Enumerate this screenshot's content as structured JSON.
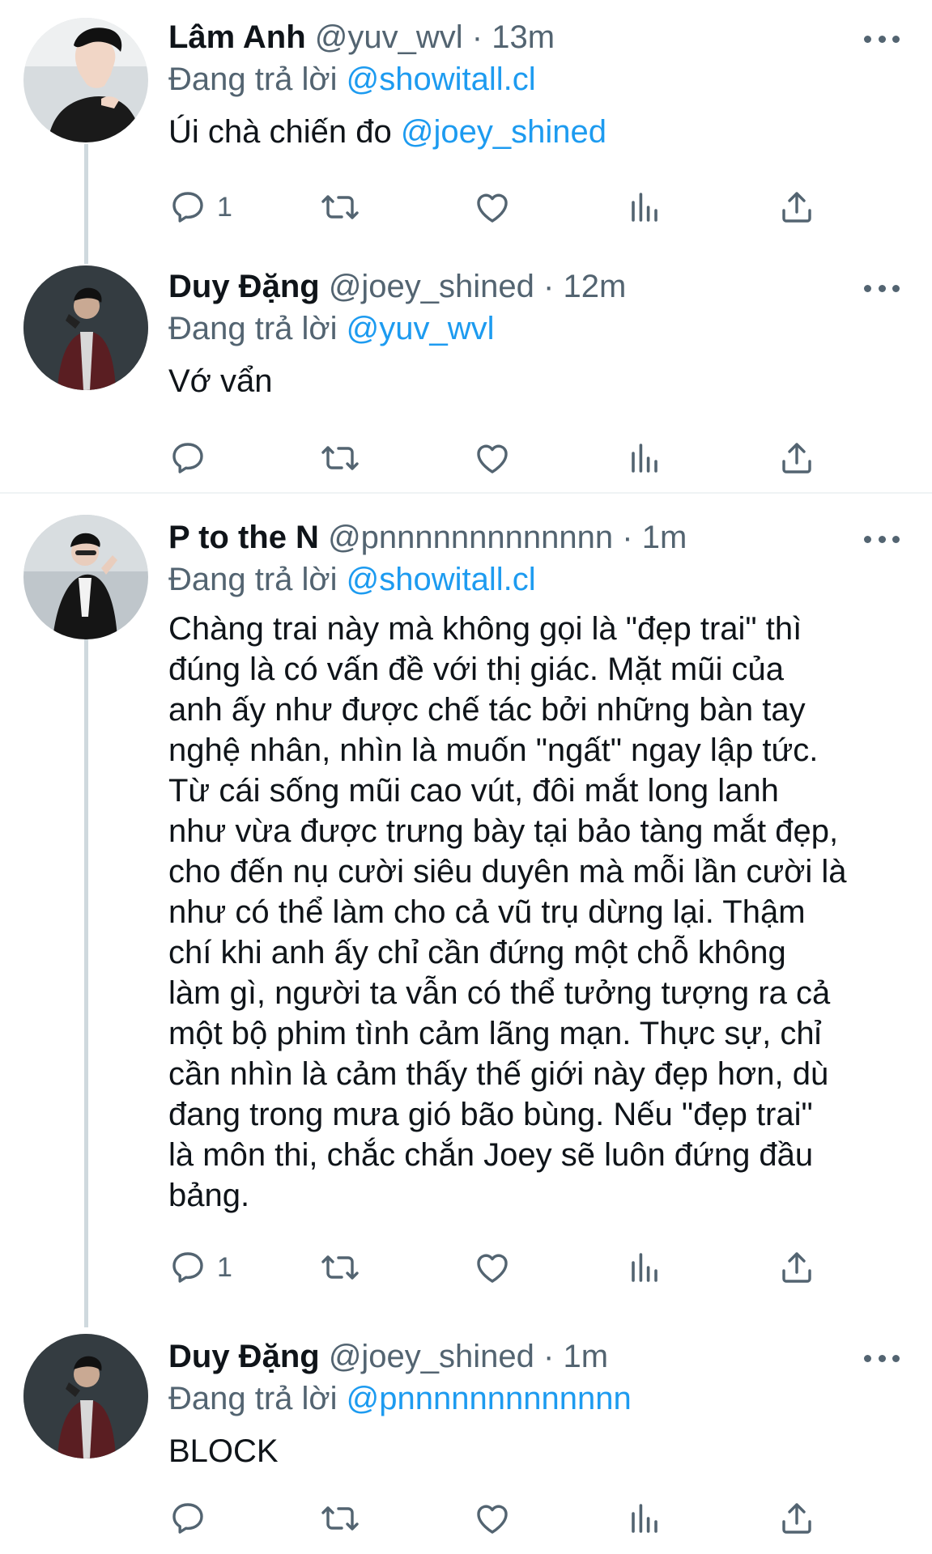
{
  "tweets": [
    {
      "display_name": "Lâm Anh",
      "handle": "@yuv_wvl",
      "separator": "·",
      "time": "13m",
      "reply_prefix": "Đang trả lời",
      "reply_to": "@showitall.cl",
      "text": "Úi chà chiến đo",
      "text_mention": "@joey_shined",
      "reply_count": "1",
      "avatar_icon": "profile-photo"
    },
    {
      "display_name": "Duy Đặng",
      "handle": "@joey_shined",
      "separator": "·",
      "time": "12m",
      "reply_prefix": "Đang trả lời",
      "reply_to": "@yuv_wvl",
      "text": "Vớ vẩn",
      "reply_count": "",
      "avatar_icon": "profile-photo"
    },
    {
      "display_name": "P to the N",
      "handle": "@pnnnnnnnnnnnnn",
      "separator": "·",
      "time": "1m",
      "reply_prefix": "Đang trả lời",
      "reply_to": "@showitall.cl",
      "text_lines": [
        "Chàng trai này mà không gọi là \"đẹp trai\" thì",
        "đúng là có vấn đề với thị giác. Mặt mũi của",
        "anh ấy như được chế tác bởi những bàn tay",
        "nghệ nhân, nhìn là muốn \"ngất\" ngay lập tức.",
        "Từ cái sống mũi cao vút, đôi mắt long lanh",
        "như vừa được trưng bày tại bảo tàng mắt đẹp,",
        "cho đến nụ cười siêu duyên mà mỗi lần cười là",
        "như có thể làm cho cả vũ trụ dừng lại. Thậm",
        "chí khi anh ấy chỉ cần đứng một chỗ không",
        "làm gì, người ta vẫn có thể tưởng tượng ra cả",
        "một bộ phim tình cảm lãng mạn. Thực sự, chỉ",
        "cần nhìn là cảm thấy thế giới này đẹp hơn, dù",
        "đang trong mưa gió bão bùng. Nếu \"đẹp trai\"",
        "là môn thi, chắc chắn Joey sẽ luôn đứng đầu",
        "bảng."
      ],
      "reply_count": "1",
      "avatar_icon": "profile-photo"
    },
    {
      "display_name": "Duy Đặng",
      "handle": "@joey_shined",
      "separator": "·",
      "time": "1m",
      "reply_prefix": "Đang trả lời",
      "reply_to": "@pnnnnnnnnnnnnn",
      "text": "BLOCK",
      "reply_count": "",
      "avatar_icon": "profile-photo"
    }
  ],
  "action_icons": [
    "reply-icon",
    "retweet-icon",
    "like-icon",
    "analytics-icon",
    "share-icon"
  ],
  "colors": {
    "accent": "#1d9bf0",
    "muted": "#536471",
    "text": "#0f1419",
    "thread_line": "#cfd9de"
  }
}
